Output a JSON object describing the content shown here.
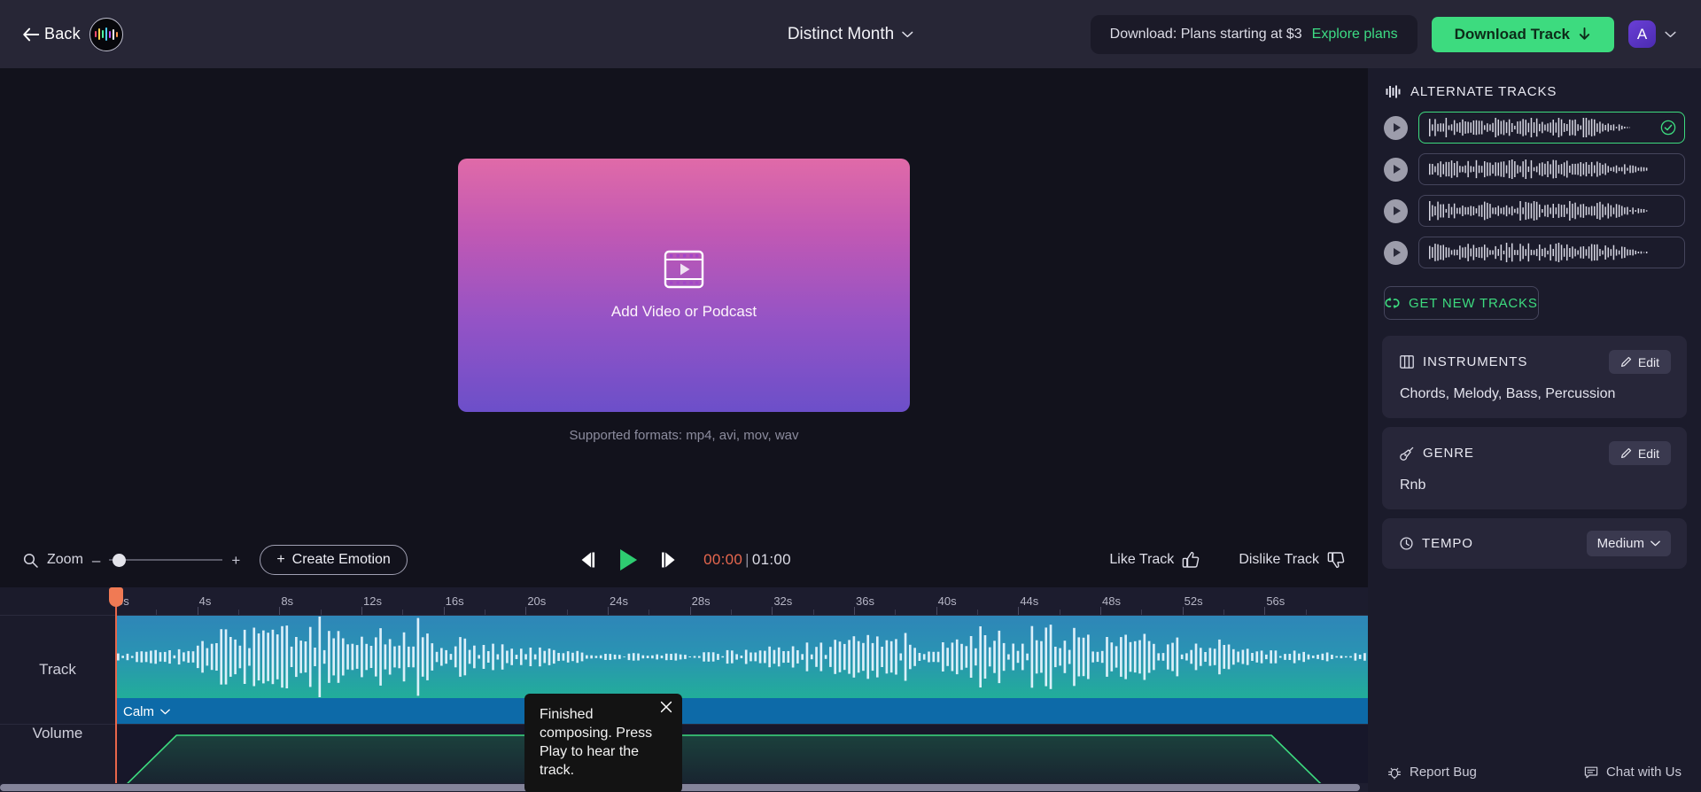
{
  "header": {
    "back_label": "Back",
    "logo_icon": "soundraw-waveform-logo",
    "title": "Distinct Month",
    "title_chevron_icon": "chevron-down-icon",
    "promo_text": "Download: Plans starting at $3",
    "promo_link": "Explore plans",
    "download_button": "Download Track",
    "download_icon": "download-arrow-icon",
    "avatar_initial": "A",
    "avatar_chevron_icon": "chevron-down-icon"
  },
  "stage": {
    "video_icon": "film-play-icon",
    "drop_label": "Add Video or Podcast",
    "formats": "Supported formats: mp4, avi, mov, wav"
  },
  "toolbar": {
    "zoom_icon": "magnifier-icon",
    "zoom_label": "Zoom",
    "zoom_minus": "–",
    "zoom_plus": "+",
    "zoom_value": 3,
    "create_emotion": "Create Emotion",
    "create_emotion_icon": "plus-icon",
    "prev_icon": "skip-back-icon",
    "play_icon": "play-icon",
    "next_icon": "skip-forward-icon",
    "current_time": "00:00",
    "time_separator": "|",
    "total_time": "01:00",
    "like_label": "Like Track",
    "like_icon": "thumbs-up-icon",
    "dislike_label": "Dislike Track",
    "dislike_icon": "thumbs-down-icon"
  },
  "timeline": {
    "track_row_label": "Track",
    "volume_row_label": "Volume",
    "clip_emotion": "Calm",
    "clip_emotion_chevron_icon": "chevron-down-icon",
    "playhead_position_seconds": 0,
    "ticks": [
      "0s",
      "4s",
      "8s",
      "12s",
      "16s",
      "20s",
      "24s",
      "28s",
      "32s",
      "36s",
      "40s",
      "44s",
      "48s",
      "52s",
      "56s"
    ],
    "tick_interval_seconds": 4,
    "duration_seconds": 60
  },
  "tooltip": {
    "message": "Finished composing. Press Play to hear the track.",
    "close_icon": "close-icon"
  },
  "sidebar": {
    "alternate_tracks": {
      "icon": "equalizer-icon",
      "title": "ALTERNATE TRACKS",
      "items": [
        {
          "play_icon": "play-icon",
          "selected": true,
          "check_icon": "check-circle-icon"
        },
        {
          "play_icon": "play-icon",
          "selected": false
        },
        {
          "play_icon": "play-icon",
          "selected": false
        },
        {
          "play_icon": "play-icon",
          "selected": false
        }
      ],
      "get_new_label": "GET NEW TRACKS",
      "get_new_icon": "refresh-icon"
    },
    "instruments": {
      "icon": "piano-icon",
      "title": "INSTRUMENTS",
      "edit_label": "Edit",
      "edit_icon": "pencil-icon",
      "value": "Chords, Melody, Bass, Percussion"
    },
    "genre": {
      "icon": "guitar-icon",
      "title": "GENRE",
      "edit_label": "Edit",
      "edit_icon": "pencil-icon",
      "value": "Rnb"
    },
    "tempo": {
      "icon": "clock-icon",
      "title": "TEMPO",
      "value": "Medium",
      "chevron_icon": "chevron-down-icon"
    },
    "footer": {
      "report_bug": "Report Bug",
      "report_bug_icon": "bug-icon",
      "chat": "Chat with Us",
      "chat_icon": "chat-bubble-icon"
    }
  },
  "colors": {
    "accent_green": "#3ddb7f",
    "playhead": "#e8664a",
    "clip_top": "#2e86b8",
    "clip_bottom": "#1fb394",
    "clip_foot": "#0d6aa8",
    "header_bg": "#272636",
    "page_bg": "#12121c",
    "sidebar_bg": "#1b1b2b"
  }
}
